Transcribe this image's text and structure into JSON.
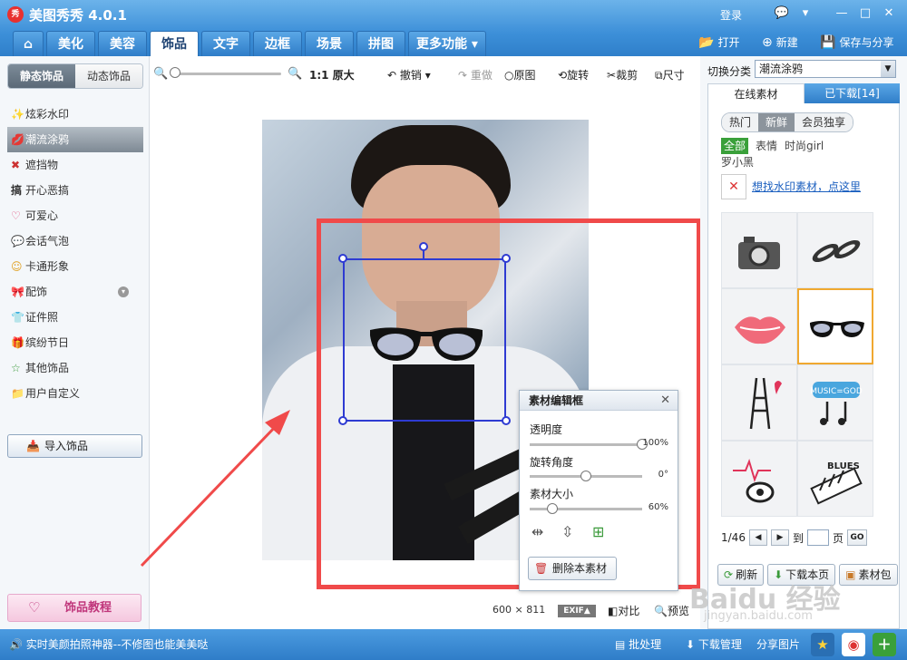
{
  "app": {
    "logo": "秀",
    "title": "美图秀秀 4.0.1",
    "login": "登录"
  },
  "window_buttons": [
    "💬",
    "▾",
    "—",
    "□",
    "✕"
  ],
  "tabs": [
    {
      "label": "⌂"
    },
    {
      "label": "美化"
    },
    {
      "label": "美容"
    },
    {
      "label": "饰品"
    },
    {
      "label": "文字"
    },
    {
      "label": "边框"
    },
    {
      "label": "场景"
    },
    {
      "label": "拼图"
    },
    {
      "label": "更多功能 ▾"
    }
  ],
  "top_actions": {
    "open": "打开",
    "new": "新建",
    "save": "保存与分享"
  },
  "left": {
    "tab_static": "静态饰品",
    "tab_dynamic": "动态饰品",
    "items": [
      {
        "icon": "✨",
        "label": "炫彩水印"
      },
      {
        "icon": "💋",
        "label": "潮流涂鸦"
      },
      {
        "icon": "✖",
        "label": "遮挡物"
      },
      {
        "icon": "搞",
        "label": "开心恶搞"
      },
      {
        "icon": "♡",
        "label": "可爱心"
      },
      {
        "icon": "💬",
        "label": "会话气泡"
      },
      {
        "icon": "☺",
        "label": "卡通形象"
      },
      {
        "icon": "🎀",
        "label": "配饰"
      },
      {
        "icon": "👕",
        "label": "证件照"
      },
      {
        "icon": "🎁",
        "label": "缤纷节日"
      },
      {
        "icon": "☆",
        "label": "其他饰品"
      },
      {
        "icon": "📁",
        "label": "用户自定义"
      }
    ],
    "expand_icon": "▾",
    "import": "导入饰品",
    "tutorial": "饰品教程"
  },
  "toolbar": {
    "zoom_out": "🔍",
    "zoom_in": "🔍",
    "ratio": "1:1 原大",
    "undo": "撤销 ▾",
    "redo": "重做",
    "original": "原图",
    "rotate": "旋转",
    "crop": "裁剪",
    "size": "尺寸"
  },
  "edit_panel": {
    "title": "素材编辑框",
    "opacity_label": "透明度",
    "opacity_value": "100%",
    "opacity": 1.0,
    "rotation_label": "旋转角度",
    "rotation_value": "0°",
    "rotation": 0.5,
    "size_label": "素材大小",
    "size_value": "60%",
    "size": 0.2,
    "delete": "删除本素材"
  },
  "canvas_footer": {
    "dims": "600 × 811",
    "exif": "EXIF▲",
    "compare": "对比",
    "preview": "预览"
  },
  "right": {
    "switch_label": "切换分类",
    "switch_value": "潮流涂鸦",
    "tab_online": "在线素材",
    "tab_downloaded": "已下载[14]",
    "pills": [
      "热门",
      "新鲜",
      "会员独享"
    ],
    "subcats": [
      "全部",
      "表情",
      "时尚girl",
      "罗小黑"
    ],
    "promo_link": "想找水印素材，点这里",
    "page": "1/46",
    "to": "到",
    "page_unit": "页",
    "go": "GO",
    "refresh": "刷新",
    "download_page": "下载本页",
    "package": "素材包"
  },
  "status": {
    "text": "实时美颜拍照神器--不修图也能美美哒",
    "batch": "批处理",
    "download_mgr": "下载管理",
    "share": "分享图片"
  },
  "watermark": {
    "main": "Baidu 经验",
    "sub": "jingyan.baidu.com"
  },
  "colors": {
    "accent": "#3c8fd8",
    "selection": "#2e3bd2",
    "highlight_frame": "#f04a4a",
    "selected_cell": "#f0a830"
  }
}
